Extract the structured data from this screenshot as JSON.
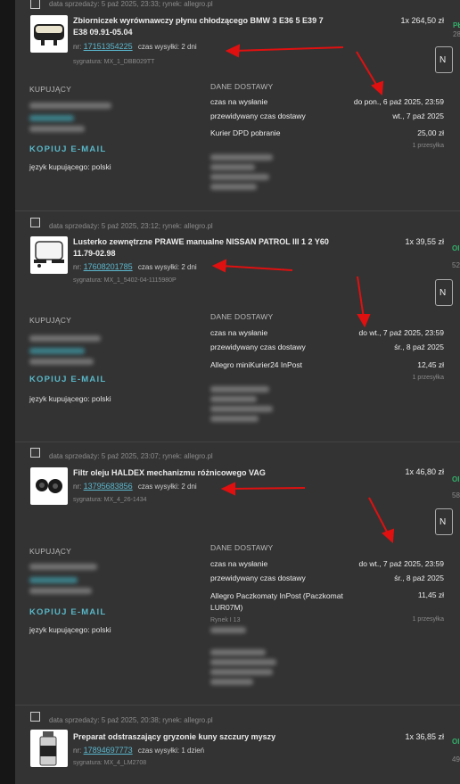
{
  "orders": [
    {
      "meta": "data sprzedaży: 5 paź 2025, 23:33; rynek: allegro.pl",
      "title": "Zbiorniczek wyrównawczy płynu chłodzącego BMW 3 E36 5 E39 7 E38 09.91-05.04",
      "qty_price": "1x 264,50 zł",
      "nr_label": "nr:",
      "nr": "17151354225",
      "ship_time": "czas wysyłki: 2 dni",
      "signature": "sygnatura: MX_1_DBB029TT",
      "buyer_label": "KUPUJĄCY",
      "copy_email": "KOPIUJ E-MAIL",
      "buyer_lang": "język kupującego: polski",
      "delivery_label": "DANE DOSTAWY",
      "rows": [
        {
          "label": "czas na wysłanie",
          "value": "do pon., 6 paź 2025, 23:59"
        },
        {
          "label": "przewidywany czas dostawy",
          "value": "wt., 7 paź 2025"
        },
        {
          "label": "Kurier DPD pobranie",
          "value": "25,00 zł"
        }
      ],
      "packages": "1 przesyłka",
      "edge": {
        "status": "PŁ",
        "num": "28"
      }
    },
    {
      "meta": "data sprzedaży: 5 paź 2025, 23:12; rynek: allegro.pl",
      "title": "Lusterko zewnętrzne PRAWE manualne NISSAN PATROL III 1 2 Y60 11.79-02.98",
      "qty_price": "1x 39,55 zł",
      "nr_label": "nr:",
      "nr": "17608201785",
      "ship_time": "czas wysyłki: 2 dni",
      "signature": "sygnatura: MX_1_5402-04-1115980P",
      "buyer_label": "KUPUJĄCY",
      "copy_email": "KOPIUJ E-MAIL",
      "buyer_lang": "język kupującego: polski",
      "delivery_label": "DANE DOSTAWY",
      "rows": [
        {
          "label": "czas na wysłanie",
          "value": "do wt., 7 paź 2025, 23:59"
        },
        {
          "label": "przewidywany czas dostawy",
          "value": "śr., 8 paź 2025"
        },
        {
          "label": "Allegro miniKurier24 InPost",
          "value": "12,45 zł"
        }
      ],
      "packages": "1 przesyłka",
      "edge": {
        "status": "OI",
        "num": "52"
      }
    },
    {
      "meta": "data sprzedaży: 5 paź 2025, 23:07; rynek: allegro.pl",
      "title": "Filtr oleju HALDEX mechanizmu różnicowego VAG",
      "qty_price": "1x 46,80 zł",
      "nr_label": "nr:",
      "nr": "13795683856",
      "ship_time": "czas wysyłki: 2 dni",
      "signature": "sygnatura: MX_4_26-1434",
      "buyer_label": "KUPUJĄCY",
      "copy_email": "KOPIUJ E-MAIL",
      "buyer_lang": "język kupującego: polski",
      "delivery_label": "DANE DOSTAWY",
      "rows": [
        {
          "label": "czas na wysłanie",
          "value": "do wt., 7 paź 2025, 23:59"
        },
        {
          "label": "przewidywany czas dostawy",
          "value": "śr., 8 paź 2025"
        },
        {
          "label": "Allegro Paczkomaty InPost (Paczkomat LUR07M)",
          "value": "11,45 zł"
        }
      ],
      "packages": "1 przesyłka",
      "rynek": "Rynek I 13",
      "edge": {
        "status": "OI",
        "num": "58"
      }
    },
    {
      "meta": "data sprzedaży: 5 paź 2025, 20:38; rynek: allegro.pl",
      "title": "Preparat odstraszający gryzonie kuny szczury myszy",
      "qty_price": "1x 36,85 zł",
      "nr_label": "nr:",
      "nr": "17894697773",
      "ship_time": "czas wysyłki: 1 dzień",
      "signature": "sygnatura: MX_4_LM2708",
      "edge": {
        "status": "OI",
        "num": "49"
      }
    }
  ],
  "edge_box_label": "N",
  "colors": {
    "background": "#333333",
    "link": "#5bb8cf",
    "accent": "#58b7c8",
    "status_green": "#2fb36a",
    "arrow": "#e01010"
  }
}
